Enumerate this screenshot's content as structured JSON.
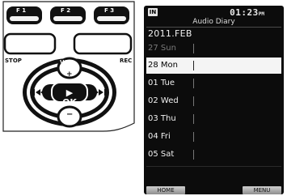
{
  "device": {
    "buttons": {
      "f1": "F 1",
      "f2": "F 2",
      "f3": "F 3",
      "stop": "STOP",
      "vol": "VOL",
      "rec": "REC",
      "ok": "▶ OK",
      "plus": "+",
      "minus": "−"
    }
  },
  "screen": {
    "input_badge": "IN",
    "clock": "01:23",
    "clock_suffix": "PM",
    "folder_title": "Audio Diary",
    "year_month": "2011.FEB",
    "days": [
      {
        "label": "27 Sun",
        "state": "dim"
      },
      {
        "label": "28 Mon",
        "state": "selected"
      },
      {
        "label": "01 Tue",
        "state": "normal"
      },
      {
        "label": "02 Wed",
        "state": "normal"
      },
      {
        "label": "03 Thu",
        "state": "normal"
      },
      {
        "label": "04 Fri",
        "state": "normal"
      },
      {
        "label": "05 Sat",
        "state": "normal"
      }
    ],
    "softkeys": {
      "left": "HOME",
      "right": "MENU"
    }
  },
  "colors": {
    "button_body": "#111111",
    "screen_background": "#0c0c0c",
    "selected_row": "#f4f4f4",
    "dim_text": "#7a7a7a"
  }
}
